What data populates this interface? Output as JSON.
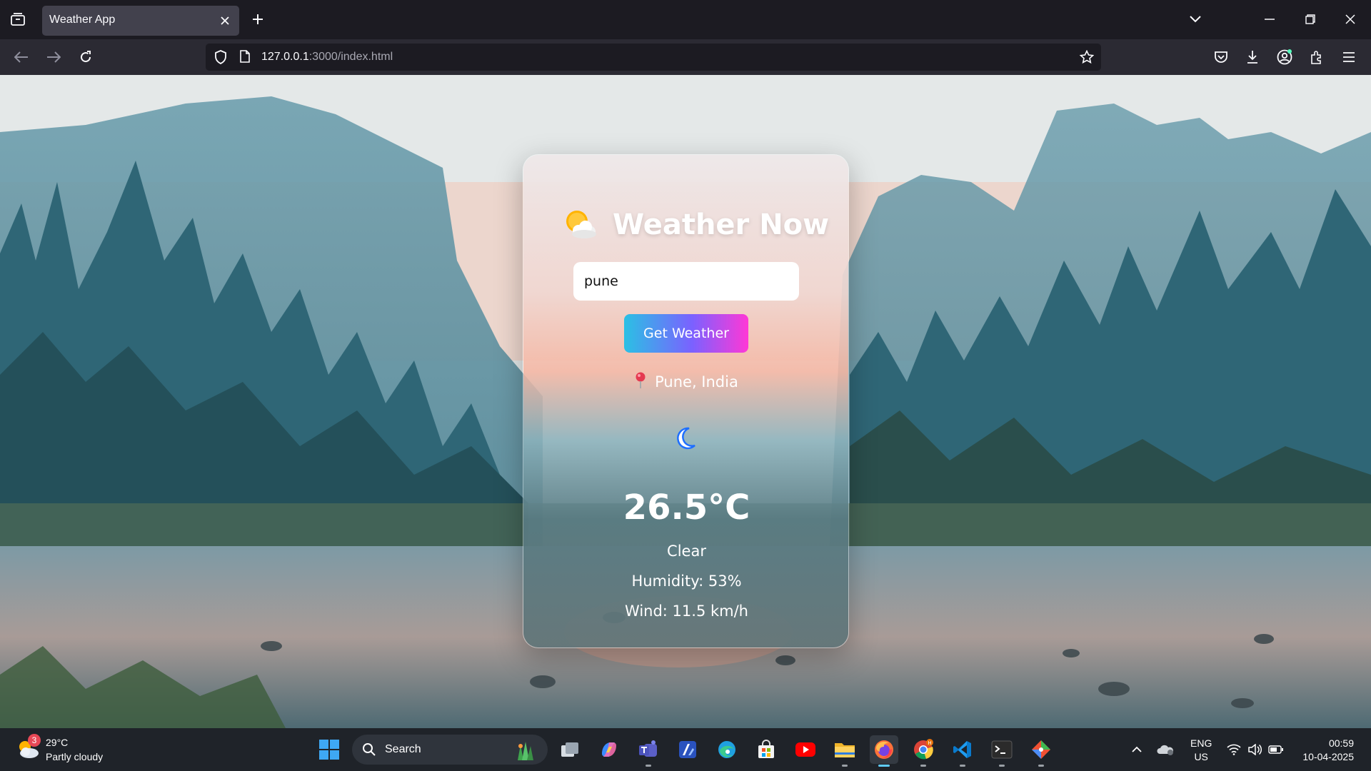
{
  "browser": {
    "tab_title": "Weather App",
    "url_host": "127.0.0.1",
    "url_path": ":3000/index.html"
  },
  "app": {
    "title": "Weather Now",
    "search_value": "pune",
    "button_label": "Get Weather",
    "location": "Pune, India",
    "temperature": "26.5°C",
    "condition": "Clear",
    "humidity": "Humidity: 53%",
    "wind": "Wind: 11.5 km/h"
  },
  "taskbar": {
    "weather_badge": "3",
    "weather_temp": "29°C",
    "weather_condition": "Partly cloudy",
    "search_label": "Search",
    "lang_line1": "ENG",
    "lang_line2": "US",
    "time": "00:59",
    "date": "10-04-2025"
  }
}
